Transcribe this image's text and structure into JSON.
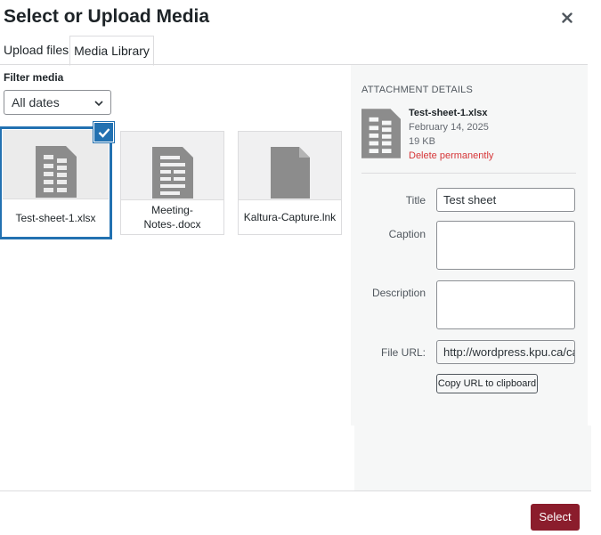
{
  "modal": {
    "title": "Select or Upload Media"
  },
  "tabs": [
    {
      "label": "Upload files"
    },
    {
      "label": "Media Library"
    }
  ],
  "filter": {
    "label": "Filter media",
    "selected": "All dates"
  },
  "attachments": [
    {
      "name": "Test-sheet-1.xlsx",
      "icon": "spreadsheet-icon",
      "selected": true
    },
    {
      "name": "Meeting-Notes-.docx",
      "icon": "document-icon",
      "selected": false
    },
    {
      "name": "Kaltura-Capture.lnk",
      "icon": "file-icon",
      "selected": false
    }
  ],
  "details": {
    "heading": "ATTACHMENT DETAILS",
    "filename": "Test-sheet-1.xlsx",
    "date": "February 14, 2025",
    "size": "19 KB",
    "delete_label": "Delete permanently",
    "fields": {
      "title_label": "Title",
      "title_value": "Test sheet",
      "caption_label": "Caption",
      "caption_value": "",
      "description_label": "Description",
      "description_value": "",
      "url_label": "File URL:",
      "url_value": "http://wordpress.kpu.ca/cam"
    },
    "copy_button": "Copy URL to clipboard"
  },
  "footer": {
    "select_label": "Select"
  },
  "colors": {
    "accent": "#2271b1",
    "select_button": "#8b1d2c",
    "danger": "#d63638"
  }
}
